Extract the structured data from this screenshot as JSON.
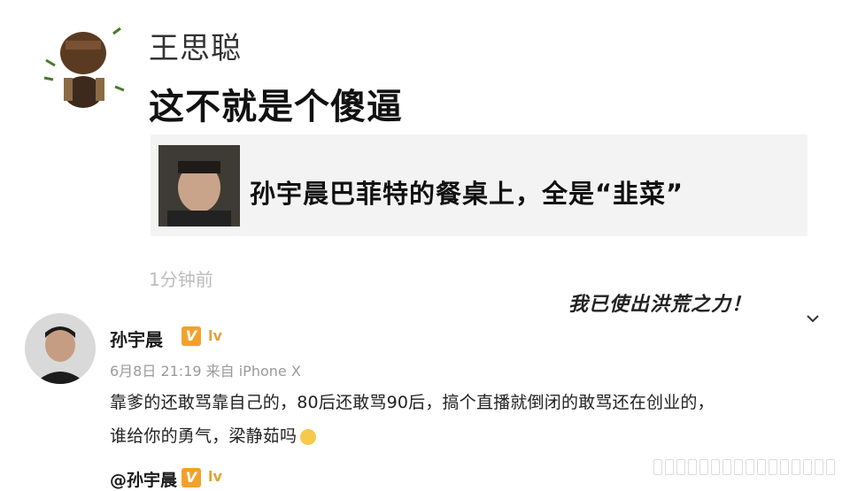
{
  "comment": {
    "author": "王思聪",
    "text": "这不就是个傻逼",
    "time": "1分钟前",
    "shared_card": {
      "title": "孙宇晨巴菲特的餐桌上，全是“韭菜”"
    },
    "sticker_text": "我已使出洪荒之力！"
  },
  "post": {
    "author": "孙宇晨",
    "verified_badge": "V",
    "level_badge": "lv",
    "meta": "6月8日 21:19 来自 iPhone X",
    "body_line1": "靠爹的还敢骂靠自己的，80后还敢骂90后，搞个直播就倒闭的敢骂还在创业的，",
    "body_line2": "谁给你的勇气，梁静茹吗",
    "emoji": "smile-emoji"
  },
  "mention": {
    "text": "@孙宇晨",
    "verified_badge": "V",
    "level_badge": "lv"
  },
  "colors": {
    "card_bg": "#f3f3f3",
    "badge_orange": "#f2a22a",
    "timestamp_gray": "#bdbdbd"
  }
}
